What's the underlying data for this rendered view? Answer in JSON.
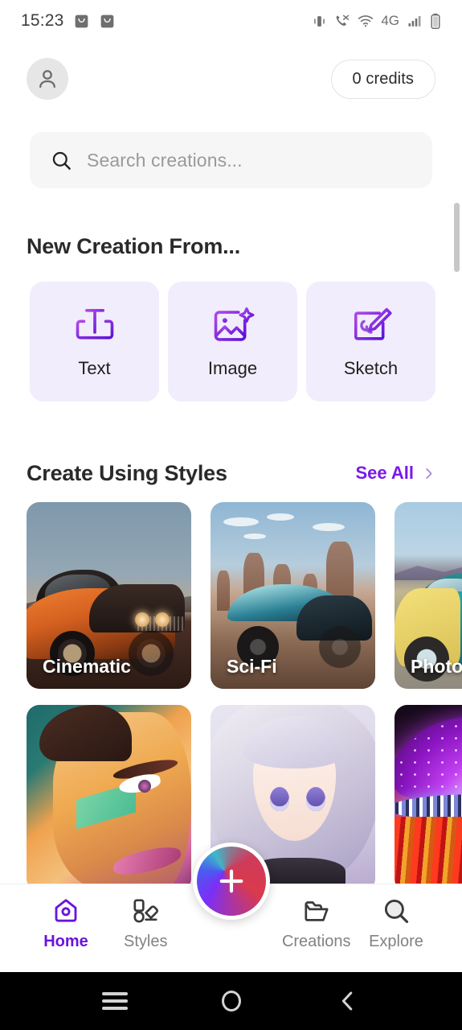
{
  "status_bar": {
    "time": "15:23",
    "left_icons": [
      "mail-icon",
      "mail-icon"
    ],
    "right_icons": [
      "vibrate-icon",
      "call-mute-icon",
      "wifi-icon",
      "signal-icon",
      "battery-icon"
    ],
    "network_label": "4G"
  },
  "header": {
    "avatar_icon": "person-icon",
    "credits_label": "0 credits"
  },
  "search": {
    "icon": "search-icon",
    "placeholder": "Search creations...",
    "value": ""
  },
  "new_creation": {
    "title": "New Creation From...",
    "cards": [
      {
        "label": "Text",
        "icon": "text-frame-icon"
      },
      {
        "label": "Image",
        "icon": "image-sparkle-icon"
      },
      {
        "label": "Sketch",
        "icon": "sketch-pencil-icon"
      }
    ]
  },
  "styles": {
    "title": "Create Using Styles",
    "see_all_label": "See All",
    "see_all_icon": "chevron-right-icon",
    "row1": [
      {
        "label": "Cinematic",
        "art": "orange-muscle-car-dusk"
      },
      {
        "label": "Sci-Fi",
        "art": "teal-futuristic-car-desert"
      },
      {
        "label": "Photography",
        "art": "yellow-teal-classic-car"
      }
    ],
    "row2": [
      {
        "label": "",
        "art": "comic-portrait"
      },
      {
        "label": "",
        "art": "anime-girl"
      },
      {
        "label": "",
        "art": "neon-mushroom"
      }
    ]
  },
  "bottom_nav": {
    "items": [
      {
        "label": "Home",
        "icon": "home-icon",
        "active": true
      },
      {
        "label": "Styles",
        "icon": "palette-icon",
        "active": false
      },
      {
        "label": "Creations",
        "icon": "folder-icon",
        "active": false
      },
      {
        "label": "Explore",
        "icon": "search-icon",
        "active": false
      }
    ],
    "fab_icon": "plus-icon"
  },
  "android_nav": {
    "buttons": [
      "recents-icon",
      "home-circle-icon",
      "back-icon"
    ]
  },
  "colors": {
    "accent_purple": "#6a14dd",
    "link_purple": "#7b19e8",
    "card_lavender": "#f1edfc",
    "search_grey": "#f6f6f6",
    "text_dark": "#2a2a2a",
    "text_muted": "#828282"
  }
}
